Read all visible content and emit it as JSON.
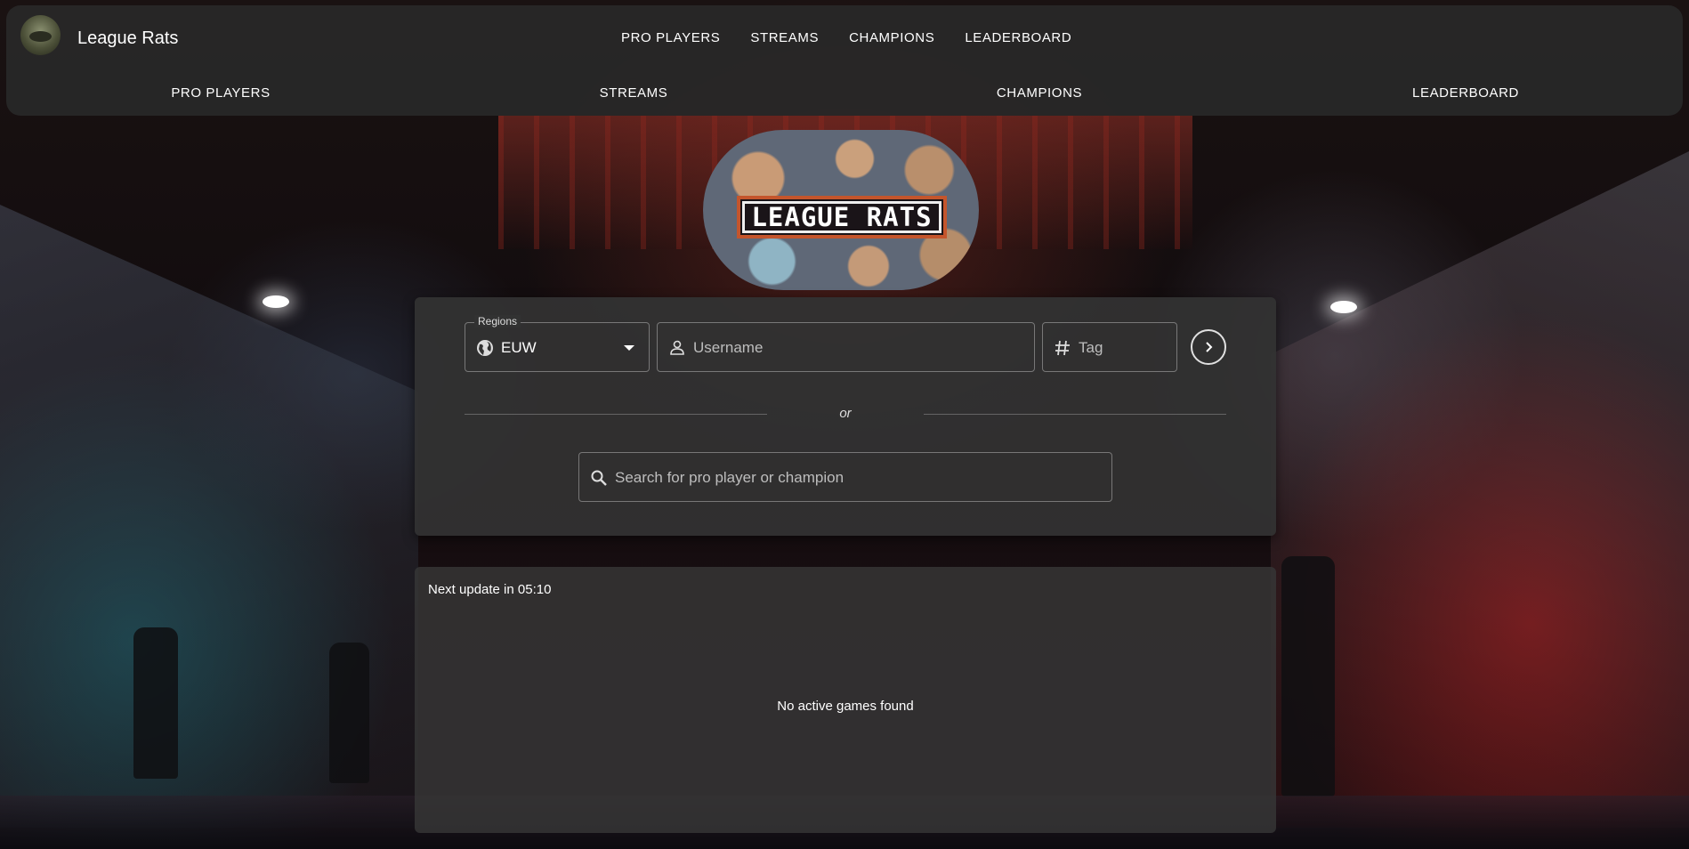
{
  "header": {
    "brand": "League Rats",
    "nav": [
      "PRO PLAYERS",
      "STREAMS",
      "CHAMPIONS",
      "LEADERBOARD"
    ],
    "subnav": [
      "PRO PLAYERS",
      "STREAMS",
      "CHAMPIONS",
      "LEADERBOARD"
    ]
  },
  "logo": {
    "text": "LEAGUE RATS"
  },
  "search": {
    "region_label": "Regions",
    "region_value": "EUW",
    "username_placeholder": "Username",
    "tag_placeholder": "Tag",
    "divider_text": "or",
    "pro_search_placeholder": "Search for pro player or champion"
  },
  "games": {
    "update_text": "Next update in 05:10",
    "empty_text": "No active games found"
  },
  "icons": {
    "region": "globe-icon",
    "username": "person-icon",
    "tag": "hash-icon",
    "go": "chevron-right-icon",
    "search": "search-icon",
    "dropdown": "caret-down-icon"
  },
  "colors": {
    "panel": "#323232",
    "header": "#282828",
    "text": "#ffffff"
  }
}
